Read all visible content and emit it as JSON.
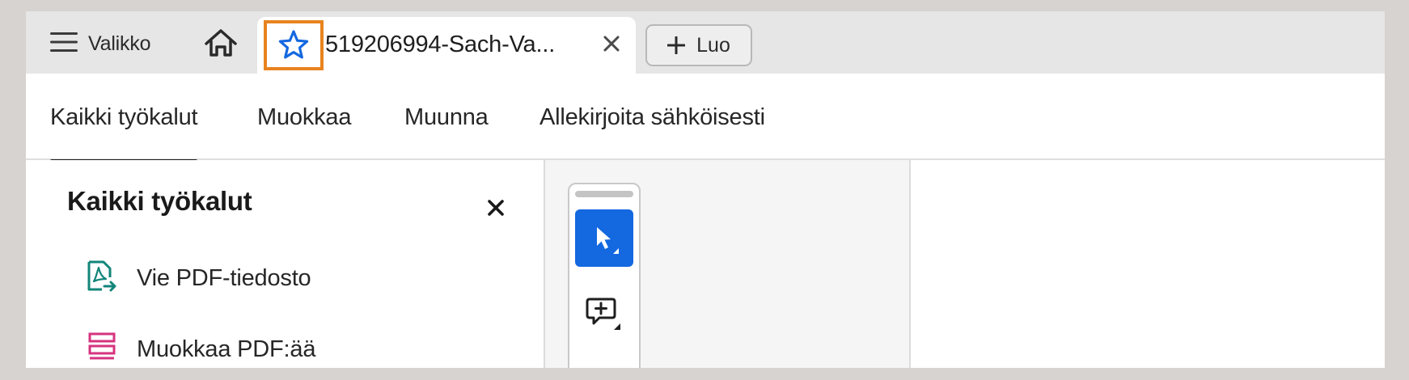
{
  "tabbar": {
    "menu_label": "Valikko",
    "doc_title": "519206994-Sach-Va...",
    "create_label": "Luo"
  },
  "topnav": {
    "tabs": [
      {
        "label": "Kaikki työkalut",
        "active": true
      },
      {
        "label": "Muokkaa",
        "active": false
      },
      {
        "label": "Muunna",
        "active": false
      },
      {
        "label": "Allekirjoita sähköisesti",
        "active": false
      }
    ]
  },
  "panel": {
    "title": "Kaikki työkalut",
    "tools": [
      {
        "label": "Vie PDF-tiedosto",
        "icon": "export-pdf-icon",
        "color": "#12857a"
      },
      {
        "label": "Muokkaa PDF:ää",
        "icon": "edit-pdf-icon",
        "color": "#d6337f"
      }
    ]
  },
  "colors": {
    "accent": "#1468e0",
    "highlight_border": "#e8831f",
    "star": "#1468e0"
  }
}
